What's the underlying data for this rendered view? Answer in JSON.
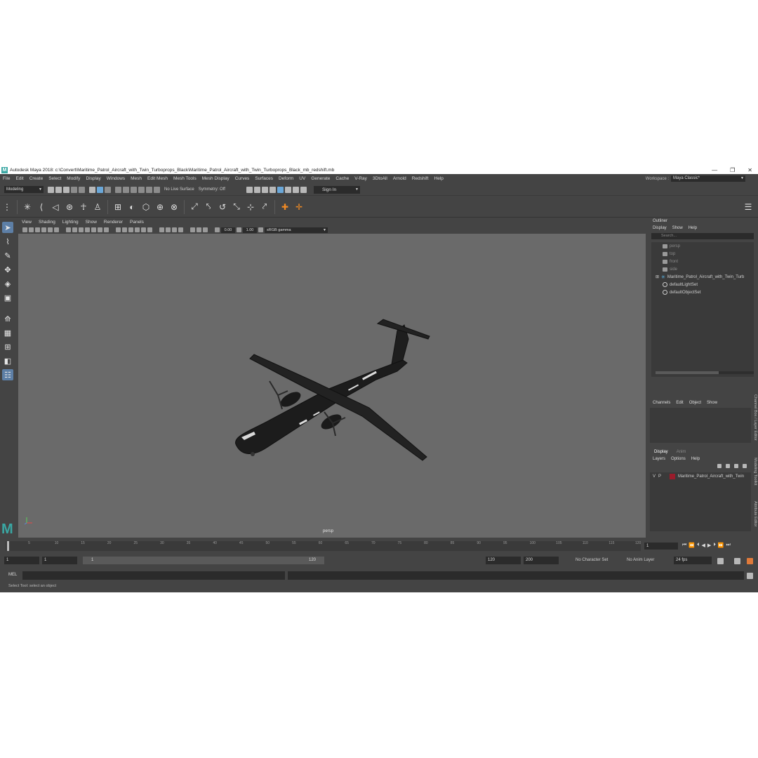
{
  "window": {
    "logo": "M",
    "title": "Autodesk Maya 2018: c:\\Convert\\Maritime_Patrol_Aircraft_with_Twin_Turboprops_Black\\Maritime_Patrol_Aircraft_with_Twin_Turboprops_Black_mb_redshift.mb",
    "minimize": "—",
    "maximize": "❐",
    "close": "✕"
  },
  "menubar": {
    "items": [
      "File",
      "Edit",
      "Create",
      "Select",
      "Modify",
      "Display",
      "Windows",
      "Mesh",
      "Edit Mesh",
      "Mesh Tools",
      "Mesh Display",
      "Curves",
      "Surfaces",
      "Deform",
      "UV",
      "Generate",
      "Cache",
      "V-Ray",
      "3DtoAll",
      "Arnold",
      "Redshift",
      "Help"
    ],
    "workspace_label": "Workspace :",
    "workspace_value": "Maya Classic*"
  },
  "statusline": {
    "mode": "Modeling",
    "live_surface": "No Live Surface",
    "symmetry": "Symmetry: Off",
    "sign_in": "Sign In"
  },
  "viewport": {
    "menus": [
      "View",
      "Shading",
      "Lighting",
      "Show",
      "Renderer",
      "Panels"
    ],
    "exposure": "0.00",
    "gamma_value": "1.00",
    "color_space": "sRGB gamma",
    "camera": "persp"
  },
  "outliner": {
    "title": "Outliner",
    "menus": [
      "Display",
      "Show",
      "Help"
    ],
    "search_placeholder": "Search...",
    "items": [
      {
        "label": "persp",
        "kind": "camera"
      },
      {
        "label": "top",
        "kind": "camera"
      },
      {
        "label": "front",
        "kind": "camera"
      },
      {
        "label": "side",
        "kind": "camera"
      },
      {
        "label": "Maritime_Patrol_Aircraft_with_Twin_Turb",
        "kind": "group"
      },
      {
        "label": "defaultLightSet",
        "kind": "set"
      },
      {
        "label": "defaultObjectSet",
        "kind": "set"
      }
    ]
  },
  "channelbox": {
    "menus": [
      "Channels",
      "Edit",
      "Object",
      "Show"
    ]
  },
  "layers": {
    "tabs": [
      "Display",
      "Anim"
    ],
    "menus": [
      "Layers",
      "Options",
      "Help"
    ],
    "row": {
      "v": "V",
      "p": "P",
      "name": "Maritime_Patrol_Aircraft_with_Twin",
      "color": "#9a1c2b"
    }
  },
  "side_tabs": [
    "Channel Box / Layer Editor",
    "Modeling Toolkit",
    "Attribute Editor"
  ],
  "timeslider": {
    "ticks": [
      "1",
      "5",
      "10",
      "15",
      "20",
      "25",
      "30",
      "35",
      "40",
      "45",
      "50",
      "55",
      "60",
      "65",
      "70",
      "75",
      "80",
      "85",
      "90",
      "95",
      "100",
      "105",
      "110",
      "115",
      "120"
    ],
    "current_frame": "1"
  },
  "rangeslider": {
    "start": "1",
    "playback_start": "1",
    "bar_start": "1",
    "bar_end": "120",
    "playback_end": "120",
    "end": "200",
    "character_set": "No Character Set",
    "anim_layer": "No Anim Layer",
    "fps": "24 fps"
  },
  "cmdline": {
    "label": "MEL",
    "help": "Select Tool: select an object"
  },
  "colors": {
    "ui_bg": "#444444",
    "viewport_bg": "#6a6a6a",
    "accent": "#5d7fa6",
    "maya_teal": "#3aa7a3"
  }
}
